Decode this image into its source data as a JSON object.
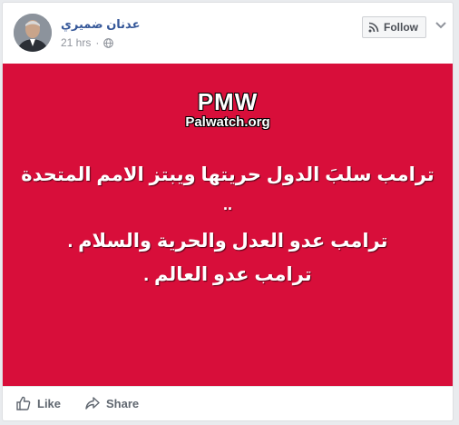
{
  "post": {
    "author_name": "عدنان ضميري",
    "timestamp": "21 hrs",
    "privacy_icon": "globe-icon",
    "follow_label": "Follow",
    "follow_icon": "rss-icon",
    "more_icon": "chevron-down-icon"
  },
  "image": {
    "background_color": "#d80e3a",
    "watermark": "PMW",
    "watermark_site": "Palwatch.org",
    "lines": [
      "ترامب سلبَ الدول حريتها ويبتز الامم المتحدة",
      "..",
      "ترامب عدو العدل والحرية والسلام .",
      "ترامب عدو العالم ."
    ]
  },
  "actions": {
    "like_label": "Like",
    "like_icon": "thumbs-up-icon",
    "share_label": "Share",
    "share_icon": "share-arrow-icon"
  }
}
